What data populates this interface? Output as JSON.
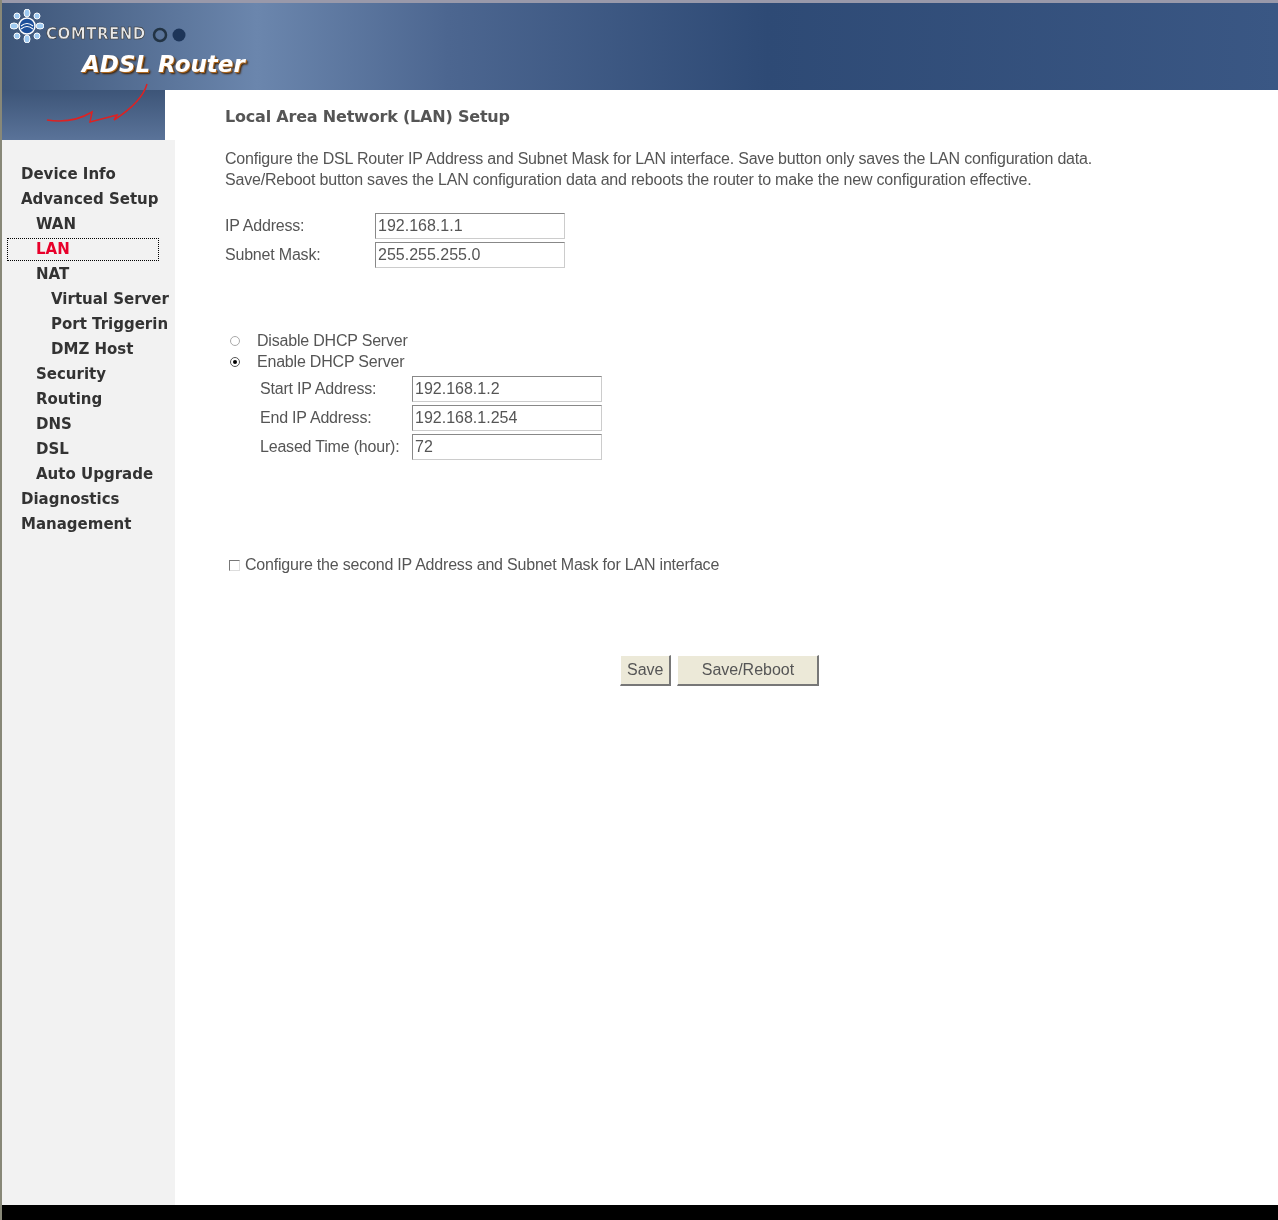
{
  "header": {
    "brand": "COMTREND",
    "product": "ADSL Router"
  },
  "sidebar": {
    "items": [
      {
        "label": "Device Info",
        "selected": false
      },
      {
        "label": "Advanced Setup",
        "selected": false,
        "children": [
          {
            "label": "WAN",
            "selected": false
          },
          {
            "label": "LAN",
            "selected": true
          },
          {
            "label": "NAT",
            "selected": false,
            "children": [
              {
                "label": "Virtual Server",
                "selected": false
              },
              {
                "label": "Port Triggerin",
                "selected": false
              },
              {
                "label": "DMZ Host",
                "selected": false
              }
            ]
          },
          {
            "label": "Security",
            "selected": false
          },
          {
            "label": "Routing",
            "selected": false
          },
          {
            "label": "DNS",
            "selected": false
          },
          {
            "label": "DSL",
            "selected": false
          },
          {
            "label": "Auto Upgrade",
            "selected": false
          }
        ]
      },
      {
        "label": "Diagnostics",
        "selected": false
      },
      {
        "label": "Management",
        "selected": false
      }
    ]
  },
  "page": {
    "title": "Local Area Network (LAN) Setup",
    "description": [
      "Configure the DSL Router IP Address and Subnet Mask for LAN interface.  Save button only saves the LAN configuration data.",
      "Save/Reboot button saves the LAN configuration data and reboots the router to make the new configuration effective."
    ],
    "fields": [
      {
        "label": "IP Address:",
        "value": "192.168.1.1"
      },
      {
        "label": "Subnet Mask:",
        "value": "255.255.255.0"
      }
    ],
    "dhcp_options": [
      {
        "label": "Disable DHCP Server",
        "selected": false
      },
      {
        "label": "Enable DHCP Server",
        "selected": true
      }
    ],
    "dhcp_fields": [
      {
        "label": "Start IP Address:",
        "value": "192.168.1.2"
      },
      {
        "label": "End IP Address:",
        "value": "192.168.1.254"
      },
      {
        "label": "Leased Time (hour):",
        "value": "72"
      }
    ],
    "second_ip": {
      "label": "Configure the second IP Address and Subnet Mask for LAN interface",
      "checked": false
    },
    "buttons": [
      "Save",
      "Save/Reboot"
    ]
  }
}
